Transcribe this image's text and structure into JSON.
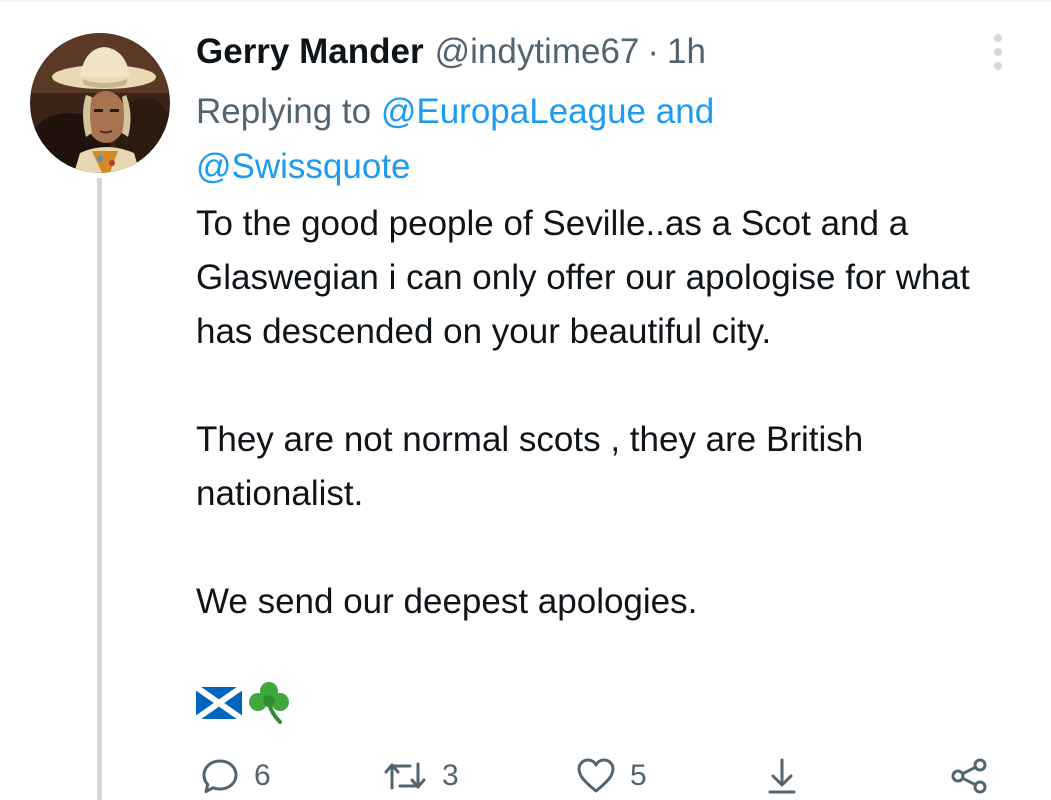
{
  "tweet": {
    "display_name": "Gerry Mander",
    "handle": "@indytime67",
    "separator": "·",
    "time": "1h",
    "replying_prefix": "Replying to",
    "reply_mention_1": "@EuropaLeague",
    "reply_and": "and",
    "reply_mention_2": "@Swissquote",
    "paragraphs": [
      "To the good people of Seville..as a Scot and a Glaswegian i can only offer our apologise for what has descended on your beautiful city.",
      "They are not normal scots ,  they are British nationalist.",
      "We send our deepest apologies."
    ],
    "emojis": [
      "scotland-flag",
      "shamrock"
    ]
  },
  "actions": {
    "reply_count": "6",
    "retweet_count": "3",
    "like_count": "5"
  },
  "icons": {
    "more": "more-vertical-icon",
    "reply": "reply-icon",
    "retweet": "retweet-icon",
    "like": "heart-icon",
    "download": "download-icon",
    "share": "share-icon"
  },
  "colors": {
    "text": "#0f1419",
    "secondary": "#536471",
    "link": "#1d9bf0",
    "thread_line": "#cfd9de",
    "icon_gray": "#536471"
  }
}
